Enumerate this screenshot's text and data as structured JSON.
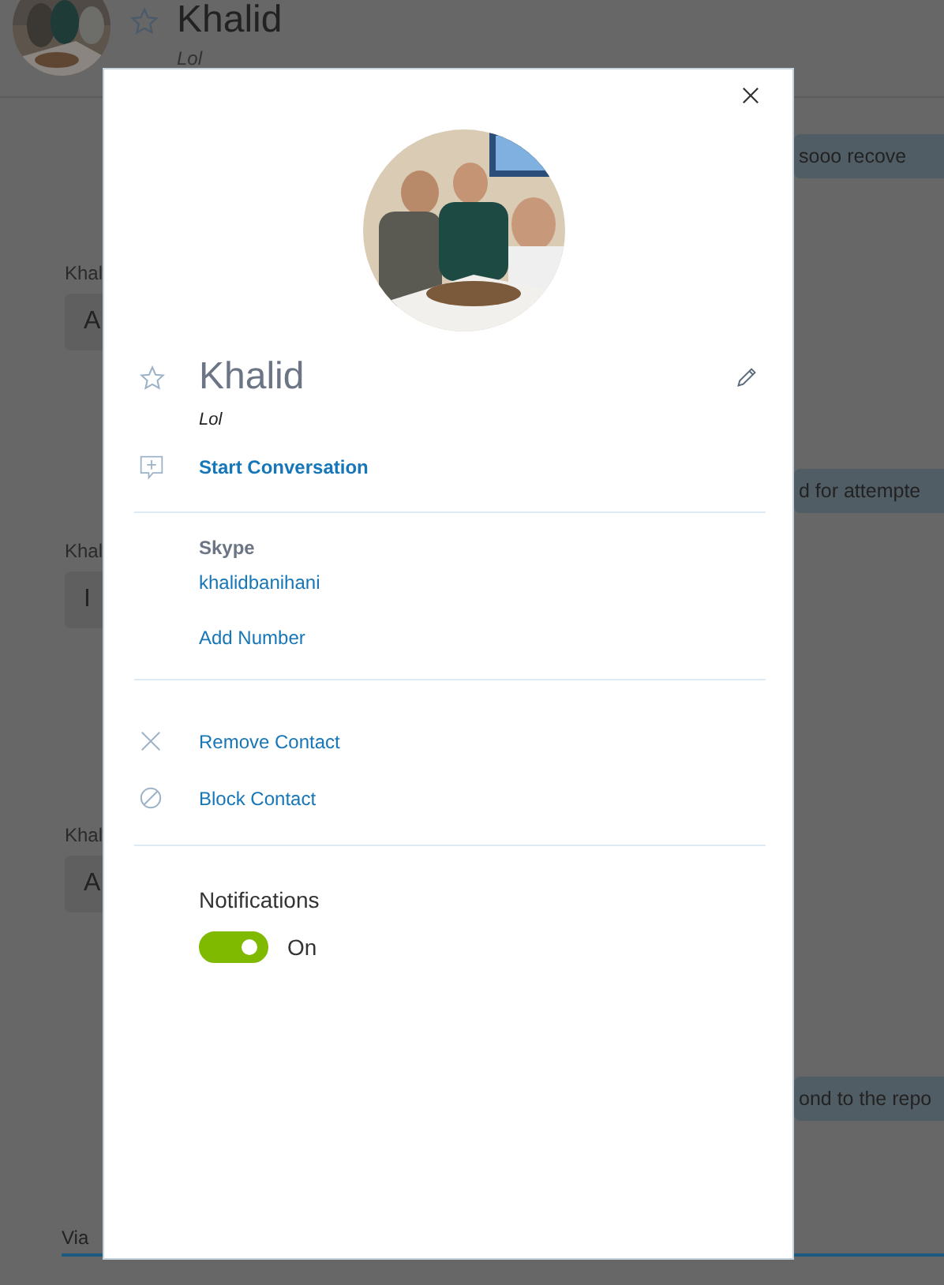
{
  "background": {
    "header": {
      "title": "Khalid",
      "mood": "Lol",
      "favorite": false
    },
    "messages": [
      {
        "kind": "outgoing",
        "text": "sooo recove"
      },
      {
        "kind": "incoming",
        "sender": "Khal",
        "text": "A"
      },
      {
        "kind": "outgoing",
        "text": "d for attempte"
      },
      {
        "kind": "incoming",
        "sender": "Khal",
        "text": "I"
      },
      {
        "kind": "incoming",
        "sender": "Khal",
        "text": "A"
      },
      {
        "kind": "outgoing",
        "text": "ond to the repo"
      }
    ],
    "composer": {
      "label": "Via"
    }
  },
  "profile_dialog": {
    "name": "Khalid",
    "favorite": false,
    "mood": "Lol",
    "start_conversation": "Start Conversation",
    "skype_label": "Skype",
    "skype_name": "khalidbanihani",
    "add_number": "Add Number",
    "actions": [
      {
        "kind": "remove",
        "label": "Remove Contact"
      },
      {
        "kind": "block",
        "label": "Block Contact"
      }
    ],
    "notifications": {
      "label": "Notifications",
      "on": true,
      "state_text": "On"
    }
  }
}
